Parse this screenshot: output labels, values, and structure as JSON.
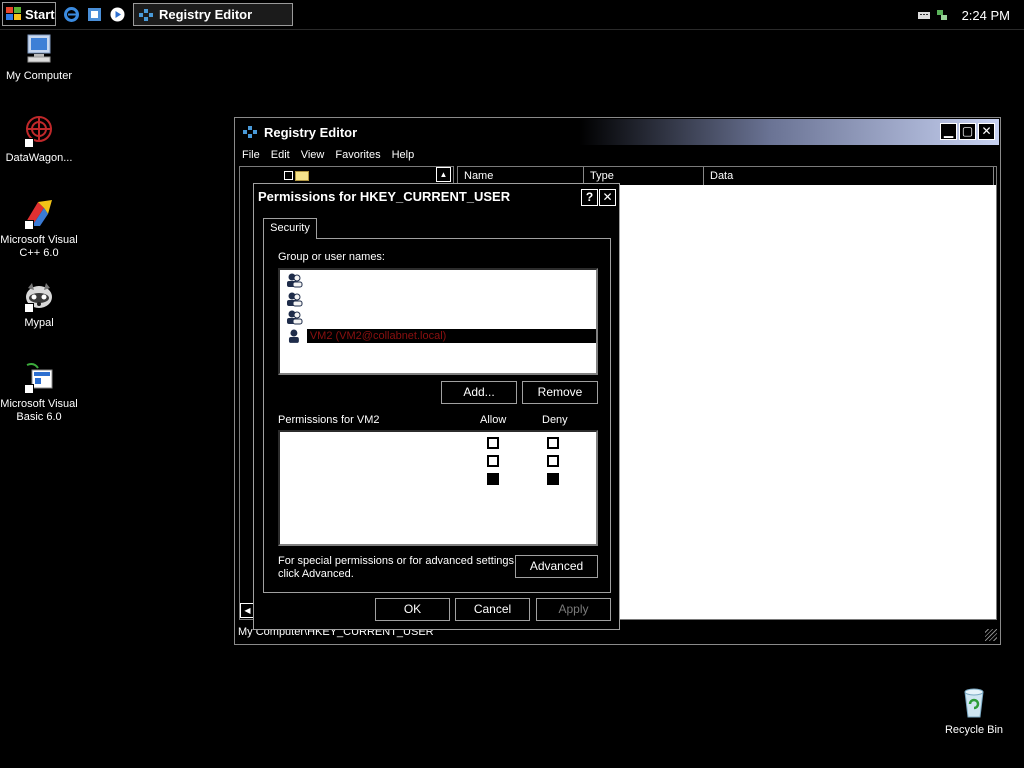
{
  "taskbar": {
    "start_label": "Start",
    "quick_launch": [
      "ie-icon",
      "outlook-express-icon",
      "media-player-icon"
    ],
    "active_task": "Registry Editor",
    "clock": "2:24 PM"
  },
  "desktop_icons": [
    {
      "label": "My Computer",
      "icon": "my-computer-icon"
    },
    {
      "label": "DataWagon...",
      "icon": "datawagon-icon"
    },
    {
      "label": "Microsoft Visual C++ 6.0",
      "icon": "visual-cpp-icon"
    },
    {
      "label": "Mypal",
      "icon": "mypal-icon"
    },
    {
      "label": "Microsoft Visual Basic 6.0",
      "icon": "visual-basic-icon"
    },
    {
      "label": "Recycle Bin",
      "icon": "recycle-bin-icon"
    }
  ],
  "regedit": {
    "title": "Registry Editor",
    "menu": [
      "File",
      "Edit",
      "View",
      "Favorites",
      "Help"
    ],
    "columns": [
      "Name",
      "Type",
      "Data"
    ],
    "status": "My Computer\\HKEY_CURRENT_USER"
  },
  "dialog": {
    "title": "Permissions for HKEY_CURRENT_USER",
    "tab": "Security",
    "group_label": "Group or user names:",
    "users": [
      {
        "name": "",
        "selected": false
      },
      {
        "name": "",
        "selected": false
      },
      {
        "name": "",
        "selected": false
      },
      {
        "name": "VM2 (VM2@collabnet.local)",
        "selected": true
      }
    ],
    "add_label": "Add...",
    "remove_label": "Remove",
    "permissions_label": "Permissions for VM2",
    "allow_label": "Allow",
    "deny_label": "Deny",
    "permissions": [
      {
        "name": "",
        "allow": false,
        "deny": false
      },
      {
        "name": "",
        "allow": false,
        "deny": false
      },
      {
        "name": "",
        "allow": true,
        "deny": true
      }
    ],
    "advanced_text": "For special permissions or for advanced settings, click Advanced.",
    "advanced_label": "Advanced",
    "ok_label": "OK",
    "cancel_label": "Cancel",
    "apply_label": "Apply"
  }
}
